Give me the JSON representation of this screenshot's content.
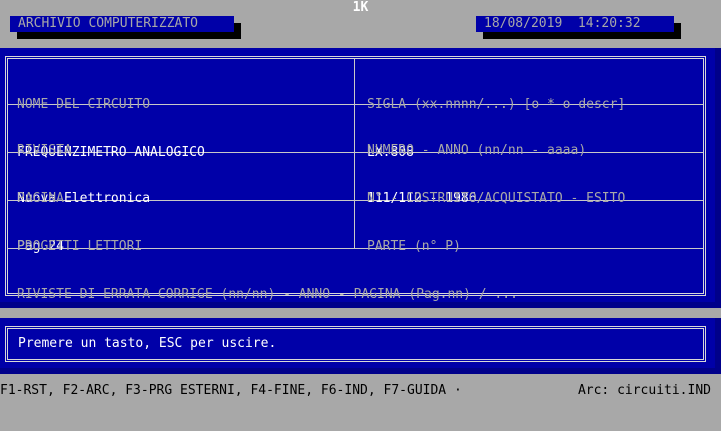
{
  "screen": {
    "top_title": "1K",
    "app_title": "ARCHIVIO COMPUTERIZZATO",
    "datetime": "18/08/2019  14:20:32"
  },
  "form": {
    "nome_label": "NOME DEL CIRCUITO",
    "nome_value": "FREQUENZIMETRO ANALOGICO",
    "sigla_label": "SIGLA (xx.nnnn/...) [o * o descr]",
    "sigla_value": "LX.808",
    "rivista_label": "RIVISTA",
    "rivista_value": "Nuova Elettronica",
    "numero_label": "NUMERO - ANNO (nn/nn - aaaa)",
    "numero_value": "111/112 - 1986",
    "pagina_label": "PAGINA",
    "pagina_value": "Pag.24",
    "costruito_label": "N° - COSTRUITO/ACQUISTATO - ESITO",
    "costruito_value": "",
    "progetti_label": "PROGETTI LETTORI",
    "progetti_value": "",
    "parte_label": "PARTE (n° P)",
    "parte_value": "",
    "errata_label": "RIVISTE DI ERRATA CORRIGE (nn/nn) - ANNO - PAGINA (Pag.nn) / ...",
    "errata_value": ""
  },
  "message": "Premere un tasto, ESC per uscire.",
  "status": {
    "fkeys": "F1-RST, F2-ARC, F3-PRG ESTERNI, F4-FINE, F6-IND, F7-GUIDA ·",
    "archive": "Arc: circuiti.IND"
  },
  "colors": {
    "background": "#a8a8a8",
    "panel_blue": "#0000a8",
    "text_grey": "#a8a8a8",
    "text_white": "#ffffff"
  }
}
